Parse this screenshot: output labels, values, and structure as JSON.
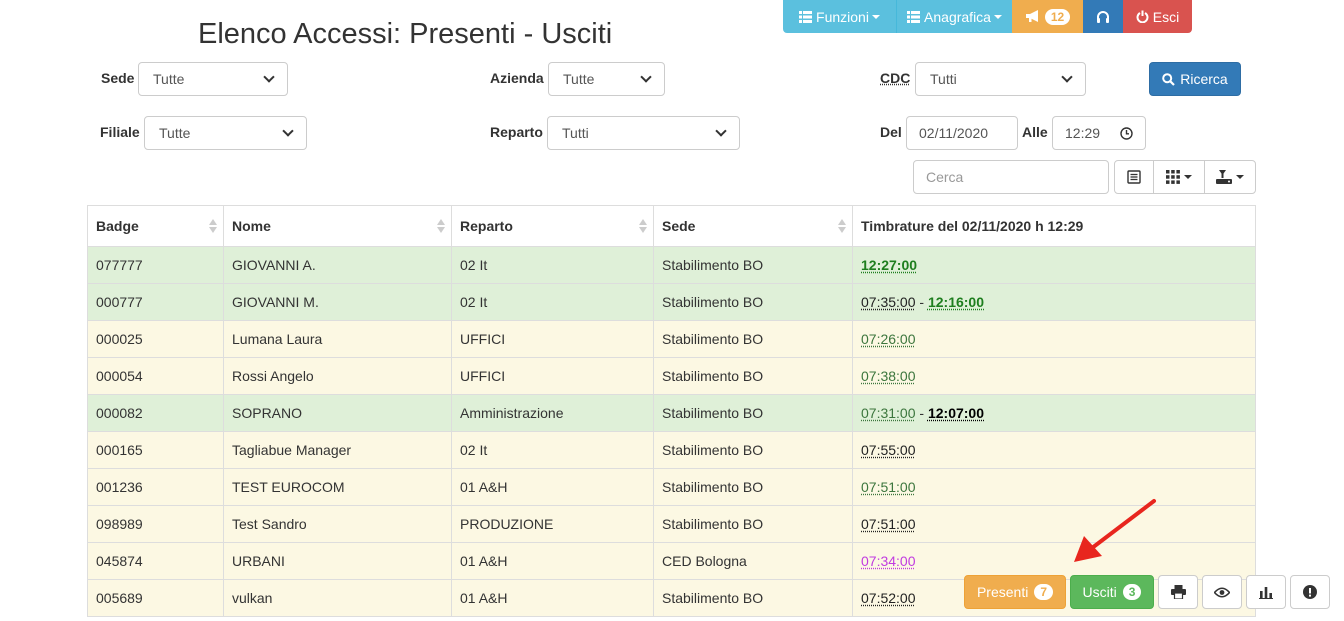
{
  "nav": {
    "funzioni": "Funzioni",
    "anagrafica": "Anagrafica",
    "notifications_count": "12",
    "esci": "Esci"
  },
  "page_title": "Elenco Accessi: Presenti - Usciti",
  "filters": {
    "sede_label": "Sede",
    "sede_value": "Tutte",
    "azienda_label": "Azienda",
    "azienda_value": "Tutte",
    "cdc_label": "CDC",
    "cdc_value": "Tutti",
    "filiale_label": "Filiale",
    "filiale_value": "Tutte",
    "reparto_label": "Reparto",
    "reparto_value": "Tutti",
    "del_label": "Del",
    "del_value": "02/11/2020",
    "alle_label": "Alle",
    "alle_value": "12:29"
  },
  "ricerca_label": "Ricerca",
  "search_placeholder": "Cerca",
  "table": {
    "headers": [
      "Badge",
      "Nome",
      "Reparto",
      "Sede",
      "Timbrature del 02/11/2020 h 12:29"
    ],
    "rows": [
      {
        "badge": "077777",
        "nome": "GIOVANNI A.",
        "reparto": "02 It",
        "sede": "Stabilimento BO",
        "t1": "12:27:00",
        "t2": ""
      },
      {
        "badge": "000777",
        "nome": "GIOVANNI M.",
        "reparto": "02 It",
        "sede": "Stabilimento BO",
        "t1": "07:35:00",
        "t2": "12:16:00"
      },
      {
        "badge": "000025",
        "nome": "Lumana Laura",
        "reparto": "UFFICI",
        "sede": "Stabilimento BO",
        "t1": "07:26:00",
        "t2": ""
      },
      {
        "badge": "000054",
        "nome": "Rossi Angelo",
        "reparto": "UFFICI",
        "sede": "Stabilimento BO",
        "t1": "07:38:00",
        "t2": ""
      },
      {
        "badge": "000082",
        "nome": "SOPRANO",
        "reparto": "Amministrazione",
        "sede": "Stabilimento BO",
        "t1": "07:31:00",
        "t2": "12:07:00"
      },
      {
        "badge": "000165",
        "nome": "Tagliabue Manager",
        "reparto": "02 It",
        "sede": "Stabilimento BO",
        "t1": "07:55:00",
        "t2": ""
      },
      {
        "badge": "001236",
        "nome": "TEST EUROCOM",
        "reparto": "01 A&H",
        "sede": "Stabilimento BO",
        "t1": "07:51:00",
        "t2": ""
      },
      {
        "badge": "098989",
        "nome": "Test Sandro",
        "reparto": "PRODUZIONE",
        "sede": "Stabilimento BO",
        "t1": "07:51:00",
        "t2": ""
      },
      {
        "badge": "045874",
        "nome": "URBANI",
        "reparto": "01 A&H",
        "sede": "CED Bologna",
        "t1": "07:34:00",
        "t2": ""
      },
      {
        "badge": "005689",
        "nome": "vulkan",
        "reparto": "01 A&H",
        "sede": "Stabilimento BO",
        "t1": "07:52:00",
        "t2": ""
      }
    ]
  },
  "bottom": {
    "presenti_label": "Presenti",
    "presenti_count": "7",
    "usciti_label": "Usciti",
    "usciti_count": "3"
  },
  "colors": {
    "info": "#5bc0de",
    "warning": "#f0ad4e",
    "primary": "#337ab7",
    "danger": "#d9534f",
    "success": "#5cb85c",
    "row_green": "#dff0d8",
    "row_yellow": "#fcf8e3",
    "arrow": "#e8261e"
  }
}
